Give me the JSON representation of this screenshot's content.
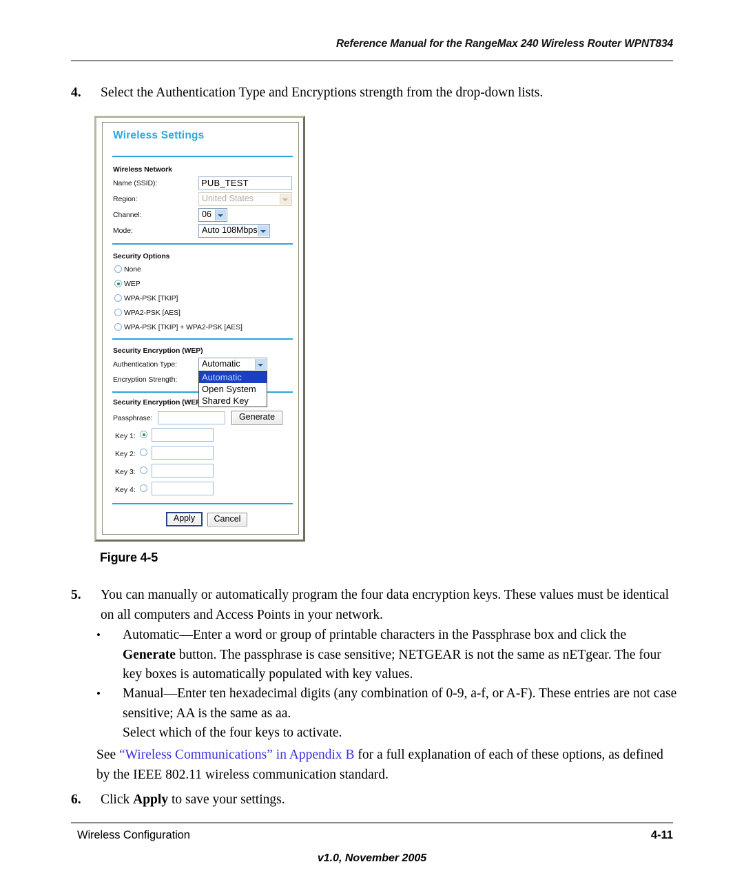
{
  "header": {
    "title": "Reference Manual for the RangeMax 240 Wireless Router WPNT834"
  },
  "steps": {
    "step4_num": "4.",
    "step4_text": "Select the Authentication Type and Encryptions strength from the drop-down lists.",
    "step5_num": "5.",
    "step5_text": "You can manually or automatically program the four data encryption keys. These values must be identical on all computers and Access Points in your network.",
    "bullet1_dot": "•",
    "bullet1_a": "Automatic—Enter a word or group of printable characters in the Passphrase box and click the ",
    "bullet1_bold": "Generate",
    "bullet1_b": " button. The passphrase is case sensitive; NETGEAR is not the same as nETgear. The four key boxes is automatically populated with key values.",
    "bullet2_dot": "•",
    "bullet2_text": "Manual—Enter ten hexadecimal digits (any combination of 0-9, a-f, or A-F). These entries are not case sensitive; AA is the same as aa.",
    "bullet2_line3": "Select which of the four keys to activate.",
    "see_pre": "See ",
    "see_link": "“Wireless Communications” in Appendix B",
    "see_post": " for a full explanation of each of these options, as defined by the IEEE 802.11 wireless communication standard.",
    "step6_num": "6.",
    "step6_pre": "Click ",
    "step6_bold": "Apply",
    "step6_post": " to save your settings."
  },
  "figure": {
    "caption": "Figure 4-5"
  },
  "footer": {
    "left": "Wireless Configuration",
    "right": "4-11",
    "center": "v1.0, November 2005"
  },
  "screenshot": {
    "title": "Wireless Settings",
    "sections": {
      "wireless_network": "Wireless Network",
      "security_options": "Security Options",
      "security_encryption": "Security Encryption (WEP)",
      "security_encryption_key": "Security Encryption (WEP) Key"
    },
    "fields": {
      "ssid_label": "Name (SSID):",
      "ssid_value": "PUB_TEST",
      "region_label": "Region:",
      "region_value": "United States",
      "channel_label": "Channel:",
      "channel_value": "06",
      "mode_label": "Mode:",
      "mode_value": "Auto 108Mbps",
      "auth_type_label": "Authentication Type:",
      "auth_type_value": "Automatic",
      "encryption_strength_label": "Encryption Strength:",
      "passphrase_label": "Passphrase:",
      "passphrase_value": "",
      "generate_label": "Generate"
    },
    "security_radios": [
      {
        "label": "None",
        "selected": false
      },
      {
        "label": "WEP",
        "selected": true
      },
      {
        "label": "WPA-PSK [TKIP]",
        "selected": false
      },
      {
        "label": "WPA2-PSK [AES]",
        "selected": false
      },
      {
        "label": "WPA-PSK [TKIP] + WPA2-PSK [AES]",
        "selected": false
      }
    ],
    "auth_type_options": [
      {
        "label": "Automatic",
        "selected": true
      },
      {
        "label": "Open System",
        "selected": false
      },
      {
        "label": "Shared Key",
        "selected": false
      }
    ],
    "keys": [
      {
        "label": "Key 1:",
        "selected": true,
        "value": ""
      },
      {
        "label": "Key 2:",
        "selected": false,
        "value": ""
      },
      {
        "label": "Key 3:",
        "selected": false,
        "value": ""
      },
      {
        "label": "Key 4:",
        "selected": false,
        "value": ""
      }
    ],
    "buttons": {
      "apply": "Apply",
      "cancel": "Cancel"
    },
    "colors": {
      "title_blue": "#27a9e1",
      "divider_blue": "#2aa3dd",
      "selected_blue": "#1a3fbf",
      "radio_green": "#1a9b35"
    }
  }
}
